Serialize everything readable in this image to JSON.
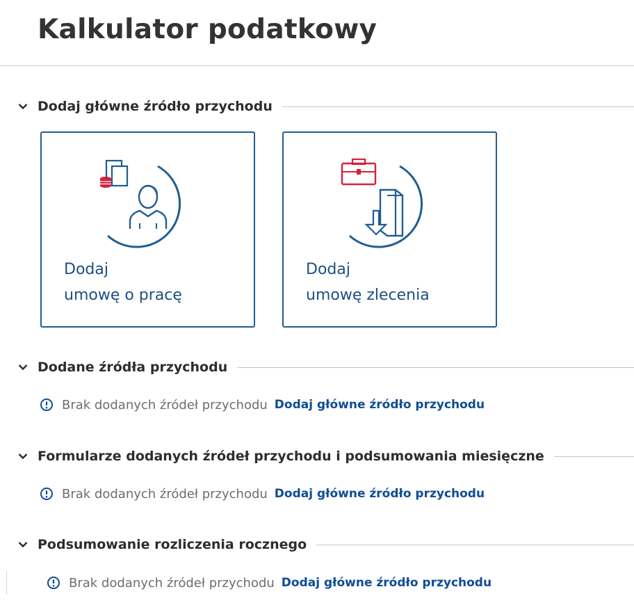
{
  "page": {
    "title": "Kalkulator podatkowy"
  },
  "sections": [
    {
      "title": "Dodaj główne źródło przychodu"
    },
    {
      "title": "Dodane źródła przychodu",
      "empty_text": "Brak dodanych źródeł przychodu",
      "link": "Dodaj główne źródło przychodu"
    },
    {
      "title": "Formularze dodanych źródeł przychodu i podsumowania miesięczne",
      "empty_text": "Brak dodanych źródeł przychodu",
      "link": "Dodaj główne źródło przychodu"
    },
    {
      "title": "Podsumowanie rozliczenia rocznego",
      "empty_text": "Brak dodanych źródeł przychodu",
      "link": "Dodaj główne źródło przychodu"
    }
  ],
  "tiles": [
    {
      "line1": "Dodaj",
      "line2": "umowę o pracę",
      "icon": "employee-contract-icon"
    },
    {
      "line1": "Dodaj",
      "line2": "umowę zlecenia",
      "icon": "commission-contract-icon"
    }
  ],
  "colors": {
    "accent_blue": "#1f5d91",
    "link_blue": "#0f4c95",
    "icon_red": "#d6203b"
  }
}
